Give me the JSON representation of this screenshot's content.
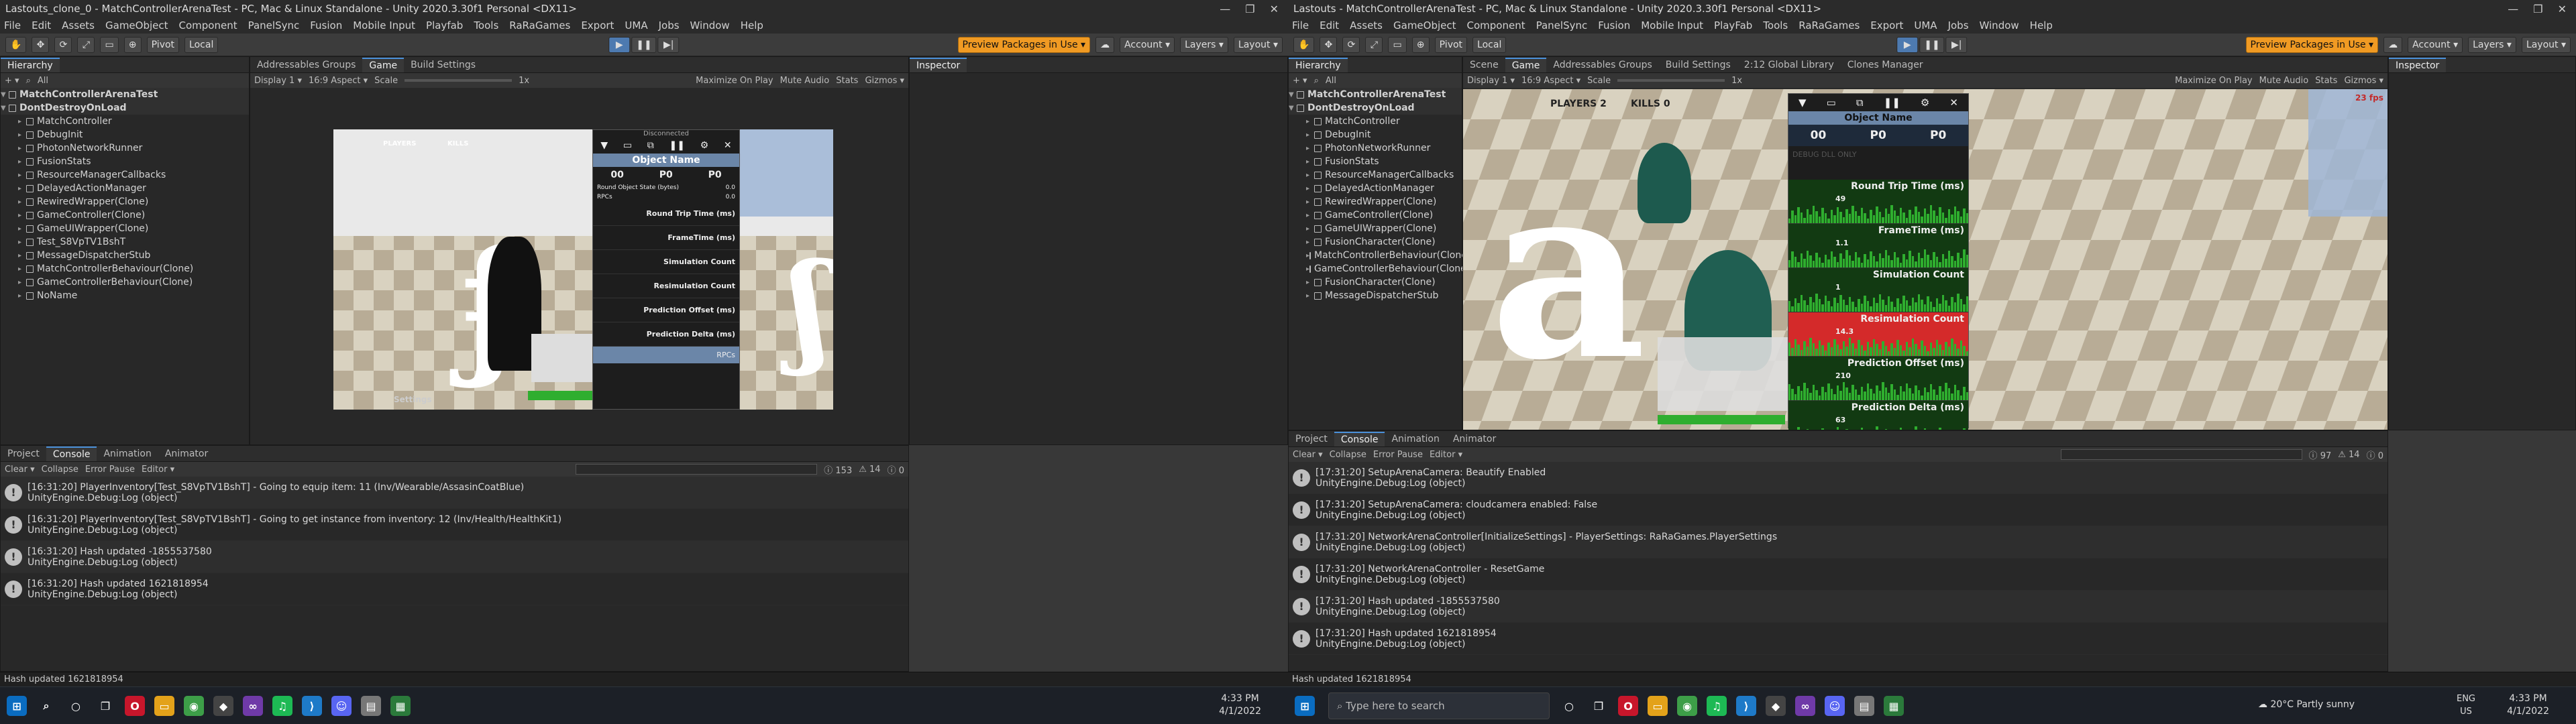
{
  "colors": {
    "accent": "#4a90d9",
    "play_active": "#4d7ab0",
    "preview": "#f09a23",
    "graph_green": "#2fae2f",
    "graph_red": "#d42a2a"
  },
  "left": {
    "title": "Lastouts_clone_0 - MatchControllerArenaTest - PC, Mac & Linux Standalone - Unity 2020.3.30f1 Personal <DX11>",
    "menu": [
      "File",
      "Edit",
      "Assets",
      "GameObject",
      "Component",
      "PanelSync",
      "Fusion",
      "Mobile Input",
      "Playfab",
      "Tools",
      "RaRaGames",
      "Export",
      "UMA",
      "Jobs",
      "Window",
      "Help"
    ],
    "toolbar": {
      "pivot": "Pivot",
      "local": "Local",
      "preview": "Preview Packages in Use ▾",
      "account": "Account ▾",
      "layers": "Layers ▾",
      "layout": "Layout ▾"
    },
    "hierarchy": {
      "tab": "Hierarchy",
      "search": "All",
      "scene": "MatchControllerArenaTest",
      "dontdestroy": "DontDestroyOnLoad",
      "items": [
        "MatchController",
        "DebugInit",
        "PhotonNetworkRunner",
        "FusionStats",
        "ResourceManagerCallbacks",
        "DelayedActionManager",
        "RewiredWrapper(Clone)",
        "GameController(Clone)",
        "GameUIWrapper(Clone)",
        "Test_S8VpTV1BshT",
        "MessageDispatcherStub",
        "MatchControllerBehaviour(Clone)",
        "GameControllerBehaviour(Clone)",
        "NoName"
      ]
    },
    "game": {
      "tabs": [
        "Addressables Groups",
        "Game",
        "Build Settings"
      ],
      "display": "Display 1 ▾",
      "aspect": "16:9 Aspect ▾",
      "scale_label": "Scale",
      "scale_val": "1x",
      "maximize": "Maximize On Play",
      "mute": "Mute Audio",
      "stats": "Stats",
      "gizmos": "Gizmos ▾",
      "hud_players": "PLAYERS",
      "hud_kills": "KILLS",
      "hud_settings": "Settings",
      "panel": {
        "title": "Object Name",
        "objid": "00",
        "input": "P0",
        "state": "P0",
        "r1": "Round Object State (bytes)",
        "r1v": "0.0",
        "r2": "RPCs",
        "r2v": "0.0",
        "graphs": [
          "Round Trip Time (ms)",
          "FrameTime (ms)",
          "Simulation Count",
          "Resimulation Count",
          "Prediction Offset (ms)",
          "Prediction Delta (ms)"
        ],
        "footer": "RPCs",
        "header": "Disconnected"
      }
    },
    "inspector": {
      "tab": "Inspector"
    },
    "console": {
      "tabs": [
        "Project",
        "Console",
        "Animation",
        "Animator"
      ],
      "clear": "Clear ▾",
      "collapse": "Collapse",
      "errorpause": "Error Pause",
      "editor": "Editor ▾",
      "count_log": "153",
      "count_warn": "14",
      "count_err": "0",
      "logs": [
        {
          "l1": "[16:31:20] PlayerInventory[Test_S8VpTV1BshT] - Going to equip item: 11 (Inv/Wearable/AssasinCoatBlue)",
          "l2": "UnityEngine.Debug:Log (object)"
        },
        {
          "l1": "[16:31:20] PlayerInventory[Test_S8VpTV1BshT] - Going to get instance from inventory: 12 (Inv/Health/HealthKit1)",
          "l2": "UnityEngine.Debug:Log (object)"
        },
        {
          "l1": "[16:31:20] Hash updated -1855537580",
          "l2": "UnityEngine.Debug:Log (object)"
        },
        {
          "l1": "[16:31:20] Hash updated 1621818954",
          "l2": "UnityEngine.Debug:Log (object)"
        }
      ]
    },
    "status": "Hash updated 1621818954"
  },
  "right": {
    "title": "Lastouts - MatchControllerArenaTest - PC, Mac & Linux Standalone - Unity 2020.3.30f1 Personal <DX11>",
    "menu": [
      "File",
      "Edit",
      "Assets",
      "GameObject",
      "Component",
      "PanelSync",
      "Fusion",
      "Mobile Input",
      "PlayFab",
      "Tools",
      "RaRaGames",
      "Export",
      "UMA",
      "Jobs",
      "Window",
      "Help"
    ],
    "toolbar": {
      "pivot": "Pivot",
      "local": "Local",
      "preview": "Preview Packages in Use ▾",
      "account": "Account ▾",
      "layers": "Layers ▾",
      "layout": "Layout ▾"
    },
    "hierarchy": {
      "tab": "Hierarchy",
      "search": "All",
      "scene": "MatchControllerArenaTest",
      "dontdestroy": "DontDestroyOnLoad",
      "items": [
        "MatchController",
        "DebugInit",
        "PhotonNetworkRunner",
        "FusionStats",
        "ResourceManagerCallbacks",
        "DelayedActionManager",
        "RewiredWrapper(Clone)",
        "GameController(Clone)",
        "GameUIWrapper(Clone)",
        "FusionCharacter(Clone)",
        "MatchControllerBehaviour(Clone)",
        "GameControllerBehaviour(Clone)",
        "FusionCharacter(Clone)",
        "MessageDispatcherStub"
      ]
    },
    "game": {
      "tabs": [
        "Scene",
        "Game",
        "Addressables Groups",
        "Build Settings",
        "2:12 Global Library",
        "Clones Manager"
      ],
      "display": "Display 1 ▾",
      "aspect": "16:9 Aspect ▾",
      "scale_label": "Scale",
      "scale_val": "1x",
      "maximize": "Maximize On Play",
      "mute": "Mute Audio",
      "stats": "Stats",
      "gizmos": "Gizmos ▾",
      "hud_players": "PLAYERS",
      "hud_players_n": "2",
      "hud_kills": "KILLS",
      "hud_kills_n": "0",
      "panel": {
        "title": "Object Name",
        "objid": "00",
        "input": "P0",
        "state": "P0",
        "graphs": [
          "Round Trip Time (ms)",
          "FrameTime (ms)",
          "Simulation Count",
          "Resimulation Count",
          "Prediction Offset (ms)",
          "Prediction Delta (ms)"
        ],
        "vals": [
          "49",
          "1.1",
          "1",
          "14.3",
          "210",
          "63"
        ],
        "watermark": "DEBUG DLL ONLY"
      },
      "fps": "23 fps"
    },
    "inspector": {
      "tab": "Inspector"
    },
    "console": {
      "tabs": [
        "Project",
        "Console",
        "Animation",
        "Animator"
      ],
      "clear": "Clear ▾",
      "collapse": "Collapse",
      "errorpause": "Error Pause",
      "editor": "Editor ▾",
      "count_log": "97",
      "count_warn": "14",
      "count_err": "0",
      "logs": [
        {
          "l1": "[17:31:20] SetupArenaCamera: Beautify Enabled",
          "l2": "UnityEngine.Debug:Log (object)"
        },
        {
          "l1": "[17:31:20] SetupArenaCamera: cloudcamera enabled: False",
          "l2": "UnityEngine.Debug:Log (object)"
        },
        {
          "l1": "[17:31:20] NetworkArenaController[InitializeSettings] - PlayerSettings: RaRaGames.PlayerSettings",
          "l2": "UnityEngine.Debug:Log (object)"
        },
        {
          "l1": "[17:31:20] NetworkArenaController - ResetGame",
          "l2": "UnityEngine.Debug:Log (object)"
        },
        {
          "l1": "[17:31:20] Hash updated -1855537580",
          "l2": "UnityEngine.Debug:Log (object)"
        },
        {
          "l1": "[17:31:20] Hash updated 1621818954",
          "l2": "UnityEngine.Debug:Log (object)"
        }
      ]
    },
    "status": "Hash updated 1621818954"
  },
  "taskbar_left": {
    "time": "4:33 PM",
    "date": "4/1/2022"
  },
  "taskbar_right": {
    "search": "Type here to search",
    "weather": "20°C  Partly sunny",
    "lang": "ENG",
    "region": "US",
    "time": "4:33 PM",
    "date": "4/1/2022"
  }
}
